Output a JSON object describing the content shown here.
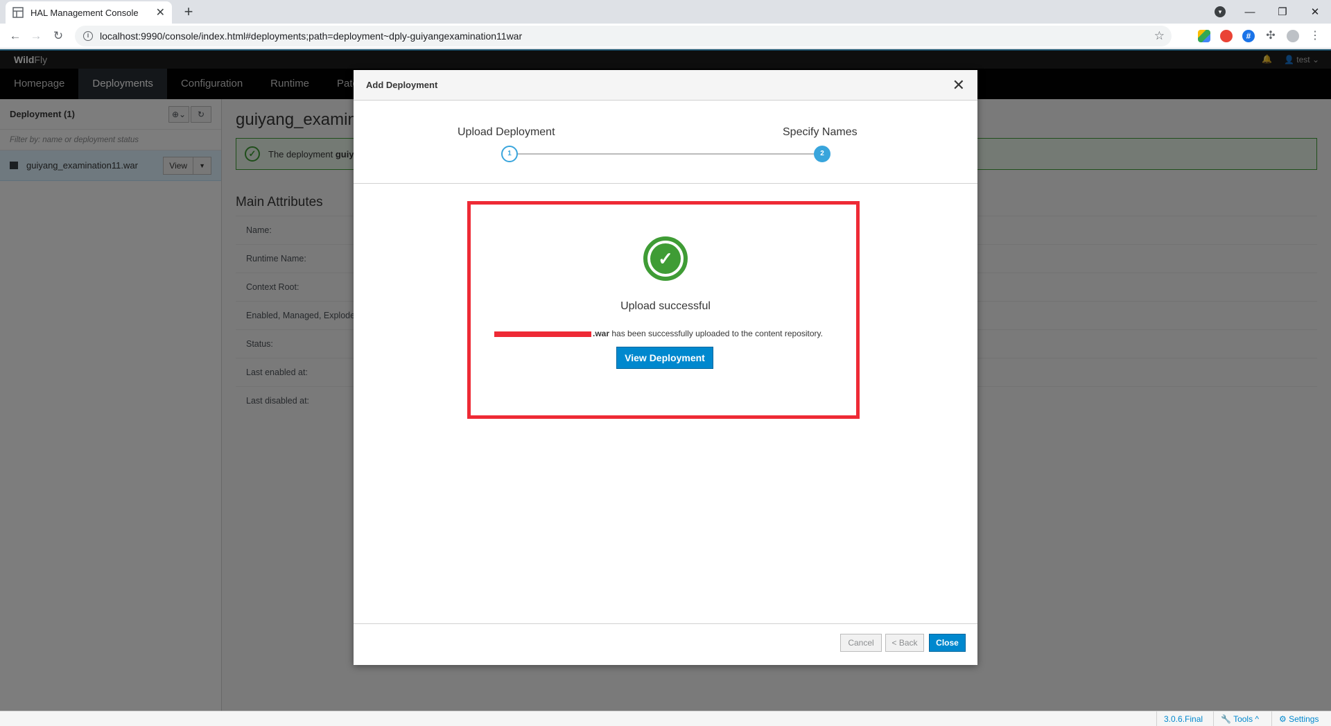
{
  "browser": {
    "tab_title": "HAL Management Console",
    "url": "localhost:9990/console/index.html#deployments;path=deployment~dply-guiyangexamination11war"
  },
  "app": {
    "brand_bold": "Wild",
    "brand_light": "Fly",
    "user": "test",
    "nav": [
      "Homepage",
      "Deployments",
      "Configuration",
      "Runtime",
      "Patc"
    ]
  },
  "sidebar": {
    "title": "Deployment (1)",
    "filter_placeholder": "Filter by: name or deployment status",
    "item_name": "guiyang_examination11.war",
    "view_label": "View"
  },
  "main": {
    "title": "guiyang_examin",
    "alert_prefix": "The deployment ",
    "alert_bold": "guiya",
    "section_title": "Main Attributes",
    "attributes": [
      "Name:",
      "Runtime Name:",
      "Context Root:",
      "Enabled, Managed, Explode",
      "Status:",
      "Last enabled at:",
      "Last disabled at:"
    ]
  },
  "modal": {
    "title": "Add Deployment",
    "steps": [
      "Upload Deployment",
      "Specify Names"
    ],
    "step_numbers": [
      "1",
      "2"
    ],
    "success_title": "Upload successful",
    "file_suffix": ".war",
    "success_message": " has been successfully uploaded to the content repository.",
    "view_button": "View Deployment",
    "cancel": "Cancel",
    "back": "< Back",
    "close": "Close"
  },
  "statusbar": {
    "version": "3.0.6.Final",
    "tools": "Tools ^",
    "settings": "Settings"
  },
  "colors": {
    "primary": "#0088ce",
    "success": "#3f9c35",
    "highlight": "#ee2a35",
    "wizard": "#39a5dc"
  }
}
